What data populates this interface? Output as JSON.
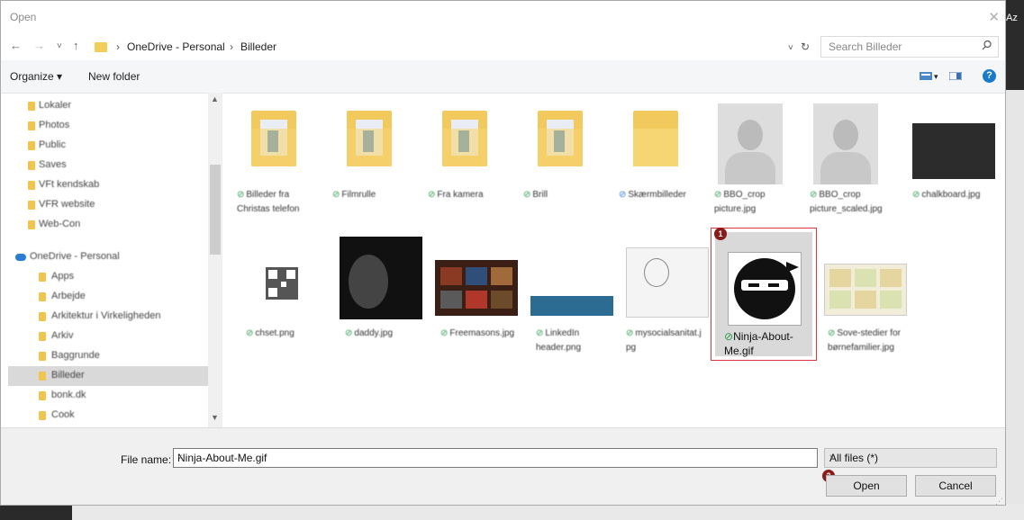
{
  "window": {
    "title": "Open",
    "close_glyph": "✕",
    "backdrop_partial_text": "Az"
  },
  "nav": {
    "back": "←",
    "forward": "→",
    "recent": "˅",
    "up": "↑"
  },
  "address": {
    "crumbs": [
      "OneDrive - Personal",
      "Billeder"
    ],
    "separator": "›",
    "dropdown": "˅",
    "refresh": "↻"
  },
  "search": {
    "placeholder": "Search Billeder",
    "icon": "search-icon"
  },
  "toolbar": {
    "organize": "Organize ▾",
    "new_folder": "New folder",
    "view_dropdown": "▾",
    "help": "?"
  },
  "sidebar": {
    "items": [
      {
        "label": "Lokaler",
        "sel": false
      },
      {
        "label": "Photos",
        "sel": false
      },
      {
        "label": "Public",
        "sel": false
      },
      {
        "label": "Saves",
        "sel": false
      },
      {
        "label": "VFt kendskab",
        "sel": false
      },
      {
        "label": "VFR website",
        "sel": false
      },
      {
        "label": "Web-Con",
        "sel": false
      },
      {
        "label": "OneDrive - Personal",
        "sel": false
      },
      {
        "label": "Apps",
        "sel": false
      },
      {
        "label": "Arbejde",
        "sel": false
      },
      {
        "label": "Arkitektur i Virkeligheden",
        "sel": false
      },
      {
        "label": "Arkiv",
        "sel": false
      },
      {
        "label": "Baggrunde",
        "sel": false
      },
      {
        "label": "Billeder",
        "sel": true
      },
      {
        "label": "bonk.dk",
        "sel": false
      },
      {
        "label": "Cook",
        "sel": false
      }
    ]
  },
  "files": {
    "row1": [
      {
        "name": "Billeder fra Christas telefon",
        "kind": "folder"
      },
      {
        "name": "Filmrulle",
        "kind": "folder"
      },
      {
        "name": "Fra kamera",
        "kind": "folder"
      },
      {
        "name": "Brill",
        "kind": "folder"
      },
      {
        "name": "Skærmbilleder",
        "kind": "folder-plain"
      },
      {
        "name": "BBO_crop picture.jpg",
        "kind": "photo"
      },
      {
        "name": "BBO_crop picture_scaled.jpg",
        "kind": "photo"
      },
      {
        "name": "chalkboard.jpg",
        "kind": "chalk"
      }
    ],
    "row2": [
      {
        "name": "chset.png",
        "kind": "qr"
      },
      {
        "name": "daddy.jpg",
        "kind": "dark"
      },
      {
        "name": "Freemasons.jpg",
        "kind": "collage"
      },
      {
        "name": "LinkedIn header.png",
        "kind": "banner"
      },
      {
        "name": "mysocialsanitat.jpg",
        "kind": "sketch"
      },
      {
        "name": "Ninja-About-Me.gif",
        "kind": "ninja",
        "selected": true
      },
      {
        "name": "Sove-stedier for børnefamilier.jpg",
        "kind": "comic"
      }
    ],
    "check_glyph": "⊘"
  },
  "badges": [
    "1",
    "2"
  ],
  "footer": {
    "file_name_label": "File name:",
    "file_name_value": "Ninja-About-Me.gif",
    "filter_value": "All files (*)",
    "open_label": "Open",
    "cancel_label": "Cancel"
  },
  "colors": {
    "accent": "#1979ca",
    "selection_border": "#d9363e",
    "badge": "#8b1a1a",
    "sync_check": "#2a9a4a"
  }
}
